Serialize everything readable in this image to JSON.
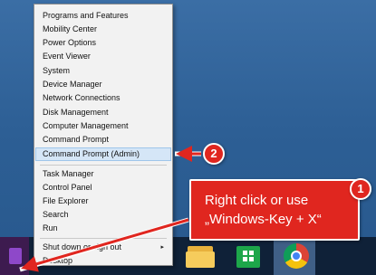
{
  "menu": {
    "items": [
      {
        "label": "Programs and Features"
      },
      {
        "label": "Mobility Center"
      },
      {
        "label": "Power Options"
      },
      {
        "label": "Event Viewer"
      },
      {
        "label": "System"
      },
      {
        "label": "Device Manager"
      },
      {
        "label": "Network Connections"
      },
      {
        "label": "Disk Management"
      },
      {
        "label": "Computer Management"
      },
      {
        "label": "Command Prompt"
      },
      {
        "label": "Command Prompt (Admin)"
      },
      {
        "label": "Task Manager"
      },
      {
        "label": "Control Panel"
      },
      {
        "label": "File Explorer"
      },
      {
        "label": "Search"
      },
      {
        "label": "Run"
      },
      {
        "label": "Shut down or sign out"
      },
      {
        "label": "Desktop"
      }
    ],
    "highlighted_item": "Command Prompt (Admin)",
    "submenu_arrow": "▸"
  },
  "annotations": {
    "step1_number": "1",
    "step2_number": "2",
    "callout_line1": "Right click or use",
    "callout_line2": "„Windows-Key + X“",
    "accent_color": "#e0261f"
  },
  "taskbar": {
    "icons": [
      "start-icon",
      "folder-icon",
      "store-icon",
      "chrome-icon"
    ]
  }
}
